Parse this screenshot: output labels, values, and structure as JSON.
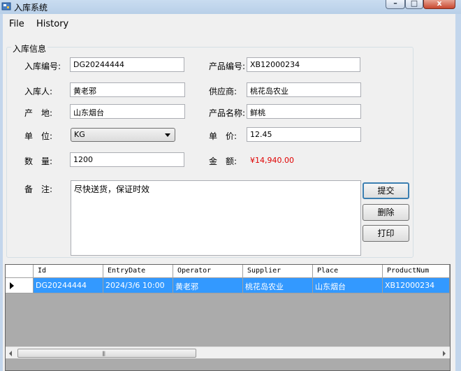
{
  "window": {
    "title": "入库系统",
    "min_glyph": "–",
    "max_glyph": "□",
    "close_glyph": "x"
  },
  "menu": {
    "file": "File",
    "history": "History"
  },
  "group": {
    "title": "入库信息"
  },
  "form": {
    "entry_no_label": "入库编号:",
    "entry_no_value": "DG20244444",
    "product_no_label": "产品编号:",
    "product_no_value": "XB12000234",
    "operator_label": "入库人:",
    "operator_value": "黄老邪",
    "supplier_label": "供应商:",
    "supplier_value": "桃花岛农业",
    "origin_label": "产　地:",
    "origin_value": "山东烟台",
    "product_name_label": "产品名称:",
    "product_name_value": "鲜桃",
    "unit_label": "单　位:",
    "unit_value": "KG",
    "price_label": "单　价:",
    "price_value": "12.45",
    "qty_label": "数　量:",
    "qty_value": "1200",
    "amount_label": "金　额:",
    "amount_value": "¥14,940.00",
    "remark_label": "备　注:",
    "remark_value": "尽快送货，保证时效"
  },
  "buttons": {
    "submit": "提交",
    "delete": "删除",
    "print": "打印"
  },
  "grid": {
    "columns": [
      "Id",
      "EntryDate",
      "Operator",
      "Supplier",
      "Place",
      "ProductNum"
    ],
    "rows": [
      [
        "DG20244444",
        "2024/3/6 10:00",
        "黄老邪",
        "桃花岛农业",
        "山东烟台",
        "XB12000234"
      ]
    ]
  },
  "scrollbar": {
    "grip": "|||"
  },
  "colors": {
    "selection": "#3399ff",
    "amount": "#e00000",
    "grid_background": "#ababab"
  }
}
